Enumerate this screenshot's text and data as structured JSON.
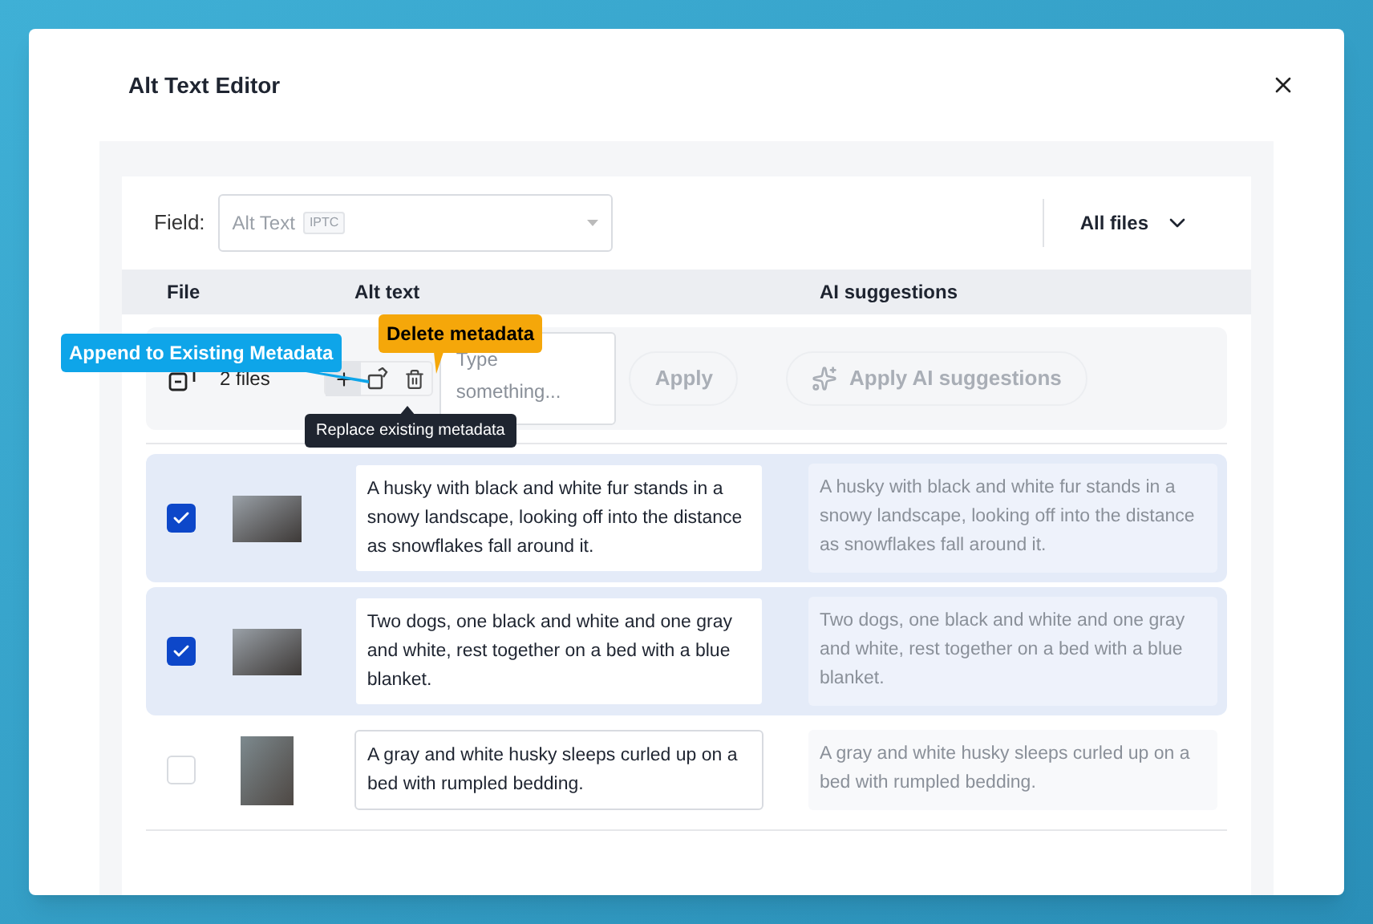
{
  "dialog": {
    "title": "Alt Text Editor"
  },
  "field": {
    "label": "Field:",
    "value": "Alt Text",
    "tag": "IPTC"
  },
  "filter": {
    "label": "All files"
  },
  "columns": [
    "File",
    "Alt text",
    "AI suggestions"
  ],
  "batch": {
    "count": "2 files",
    "placeholder": "Type something...",
    "apply": "Apply",
    "apply_ai": "Apply AI suggestions"
  },
  "callouts": [
    {
      "kind": "append",
      "text": "Append to Existing Metadata",
      "color": "#0ea5e9"
    },
    {
      "kind": "delete",
      "text": "Delete metadata",
      "color": "#f5a70a"
    },
    {
      "kind": "replace",
      "text": "Replace existing metadata",
      "color": "#1f2530"
    }
  ],
  "rows": [
    {
      "selected": true,
      "kind": "landscape",
      "alt_text": "A husky with black and white fur stands in a snowy landscape, looking off into the distance as snowflakes fall around it.",
      "suggestion": "A husky with black and white fur stands in a snowy landscape, looking off into the distance as snowflakes fall around it."
    },
    {
      "selected": true,
      "kind": "landscape",
      "alt_text": "Two dogs, one black and white and one gray and white, rest together on a bed with a blue blanket.",
      "suggestion": "Two dogs, one black and white and one gray and white, rest together on a bed with a blue blanket."
    },
    {
      "selected": false,
      "kind": "portrait",
      "alt_text": "A gray and white husky sleeps curled up on a bed with rumpled bedding.",
      "suggestion": "A gray and white husky sleeps curled up on a bed with rumpled bedding."
    }
  ]
}
